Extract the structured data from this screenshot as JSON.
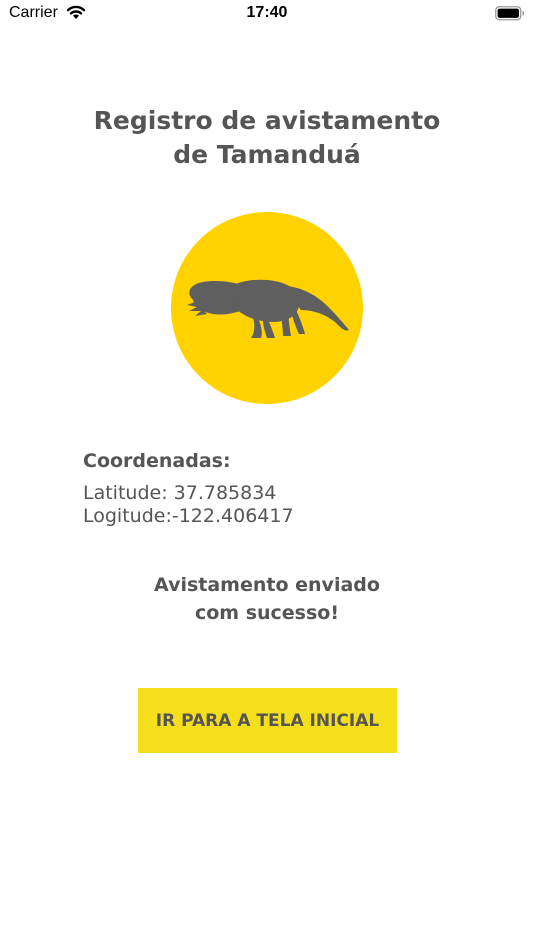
{
  "status_bar": {
    "carrier": "Carrier",
    "time": "17:40",
    "wifi_icon": "wifi-icon",
    "battery_icon": "battery-icon"
  },
  "title": {
    "line1": "Registro de avistamento",
    "line2": "de Tamanduá"
  },
  "animal": {
    "icon": "anteater-silhouette-icon",
    "circle_color": "#ffd200",
    "silhouette_color": "#5f5f5f"
  },
  "coordinates": {
    "heading": "Coordenadas:",
    "latitude_line": "Latitude: 37.785834",
    "longitude_line": "Logitude:-122.406417"
  },
  "message": {
    "line1": "Avistamento enviado",
    "line2": "com sucesso!"
  },
  "button": {
    "label": "IR PARA A TELA INICIAL",
    "color": "#f5df1a"
  }
}
